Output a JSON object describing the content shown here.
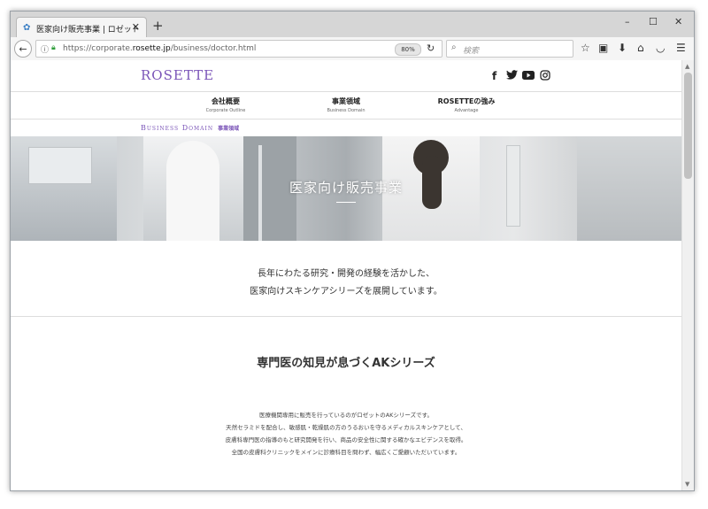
{
  "browser": {
    "tab_title": "医家向け販売事業 | ロゼット",
    "tab_close": "✕",
    "new_tab": "+",
    "url_prefix": "https://corporate.",
    "url_domain": "rosette.jp",
    "url_path": "/business/doctor.html",
    "zoom": "80%",
    "search_placeholder": "検索",
    "window_buttons": {
      "minimize": "–",
      "maximize": "☐",
      "close": "✕"
    }
  },
  "site": {
    "logo": "ROSETTE",
    "social": {
      "facebook": "f",
      "twitter": "t",
      "youtube": "▶",
      "instagram": "◎"
    },
    "nav": [
      {
        "jp": "会社概要",
        "en": "Corporate Outline"
      },
      {
        "jp": "事業領域",
        "en": "Business Domain"
      },
      {
        "jp": "ROSETTEの強み",
        "en": "Advantage"
      }
    ],
    "breadcrumb": {
      "en": "Business Domain",
      "jp": "事業領域"
    },
    "hero_title": "医家向け販売事業",
    "intro": [
      "長年にわたる研究・開発の経験を活かした、",
      "医家向けスキンケアシリーズを展開しています。"
    ],
    "section_heading": "専門医の知見が息づくAKシリーズ",
    "body": [
      "医療機関専用に販売を行っているのがロゼットのAKシリーズです。",
      "天然セラミドを配合し、敏感肌・乾燥肌の方のうるおいを守るメディカルスキンケアとして、",
      "皮膚科専門医の指導のもと研究開発を行い、商品の安全性に関する確かなエビデンスを取得。",
      "全国の皮膚科クリニックをメインに診療科目を問わず、幅広くご愛顧いただいています。"
    ]
  },
  "colors": {
    "brand_purple": "#7b55b8"
  }
}
